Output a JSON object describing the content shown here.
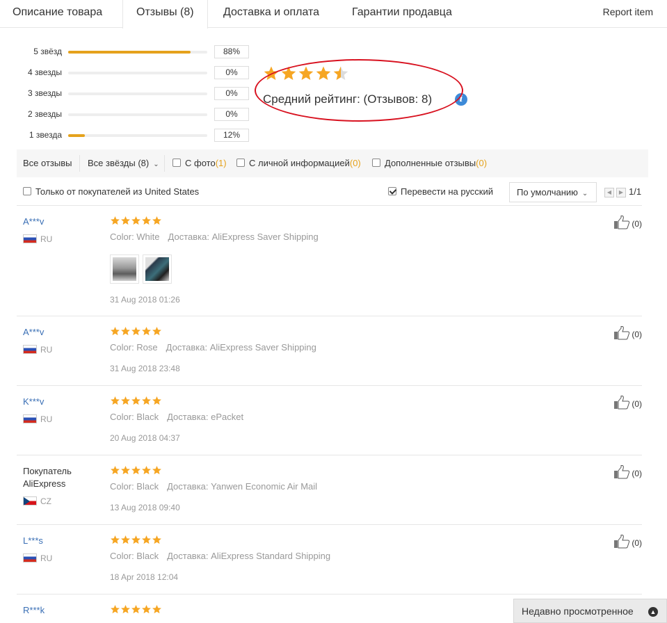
{
  "tabs": [
    {
      "label": "Описание товара"
    },
    {
      "label": "Отзывы (8)"
    },
    {
      "label": "Доставка и оплата"
    },
    {
      "label": "Гарантии продавца"
    }
  ],
  "report_label": "Report item",
  "histogram": [
    {
      "label": "5 звёзд",
      "percent": "88%",
      "fill": 0.88
    },
    {
      "label": "4 звезды",
      "percent": "0%",
      "fill": 0
    },
    {
      "label": "3 звезды",
      "percent": "0%",
      "fill": 0
    },
    {
      "label": "2 звезды",
      "percent": "0%",
      "fill": 0
    },
    {
      "label": "1 звезда",
      "percent": "12%",
      "fill": 0.12
    }
  ],
  "average": {
    "stars": 4.5,
    "label": "Средний рейтинг:  (Отзывов: 8)",
    "info_icon": "info-icon"
  },
  "filters": {
    "all_reviews": "Все отзывы",
    "all_stars": "Все звёзды (8)",
    "with_photo": "С фото",
    "with_photo_count": "(1)",
    "personal_info": "С личной информацией",
    "personal_info_count": "(0)",
    "additional": "Дополненные отзывы",
    "additional_count": "(0)",
    "only_country": "Только от покупателей из United States",
    "translate": "Перевести на русский",
    "sort": "По умолчанию",
    "page": "1/1"
  },
  "reviews": [
    {
      "name": "A***v",
      "country": "RU",
      "stars": 5,
      "color": "Color: White",
      "delivery": "Доставка: AliExpress Saver Shipping",
      "date": "31 Aug 2018 01:26",
      "likes": "(0)",
      "photos": 2
    },
    {
      "name": "A***v",
      "country": "RU",
      "stars": 5,
      "color": "Color: Rose",
      "delivery": "Доставка: AliExpress Saver Shipping",
      "date": "31 Aug 2018 23:48",
      "likes": "(0)"
    },
    {
      "name": "K***v",
      "country": "RU",
      "stars": 5,
      "color": "Color: Black",
      "delivery": "Доставка: ePacket",
      "date": "20 Aug 2018 04:37",
      "likes": "(0)"
    },
    {
      "name": "Покупатель AliExpress",
      "country": "CZ",
      "stars": 5,
      "color": "Color: Black",
      "delivery": "Доставка: Yanwen Economic Air Mail",
      "date": "13 Aug 2018 09:40",
      "likes": "(0)"
    },
    {
      "name": "L***s",
      "country": "RU",
      "stars": 5,
      "color": "Color: Black",
      "delivery": "Доставка: AliExpress Standard Shipping",
      "date": "18 Apr 2018 12:04",
      "likes": "(0)"
    },
    {
      "name": "R***k",
      "country": "",
      "stars": 5,
      "color": "",
      "delivery": "",
      "date": "",
      "likes": ""
    }
  ],
  "recently_viewed": "Недавно просмотренное",
  "colors": {
    "star": "#f6a623",
    "bar": "#e5a21c",
    "link": "#3a6fb5",
    "annotation": "#d8111f"
  }
}
